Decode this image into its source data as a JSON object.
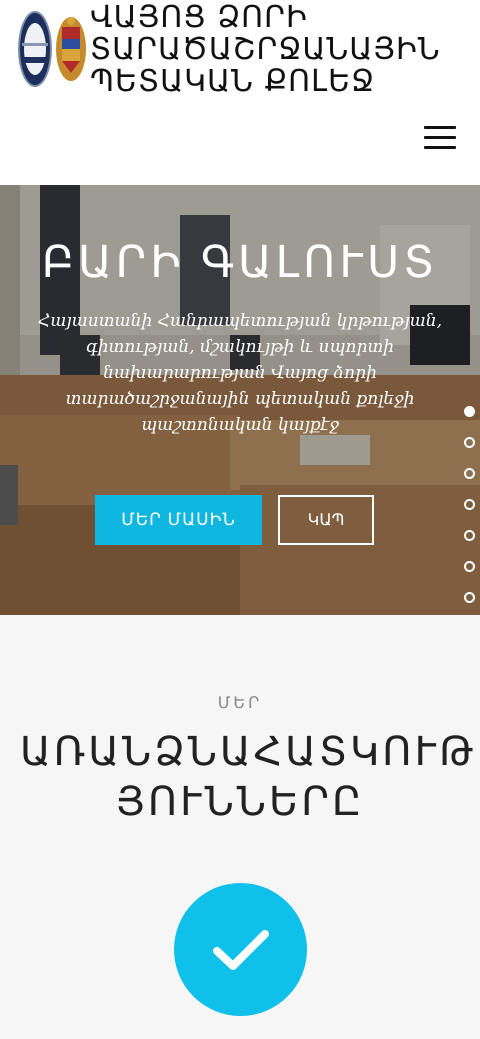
{
  "header": {
    "title": "ՎԱՅՈՑ ՁՈՐԻ ՏԱՐԱԾԱՇՐՋԱՆԱՅԻՆ ՊԵՏԱԿԱՆ ՔՈԼԵՋ",
    "logo_icon": "college-seal-icon",
    "crest_icon": "armenia-coat-of-arms-icon",
    "menu_icon": "hamburger-menu-icon"
  },
  "hero": {
    "title": "ԲԱՐԻ ԳԱԼՈՒՍՏ",
    "subtitle": "Հայաստանի Հանրապետության կրթության, գիտության, մշակույթի և սպորտի նախարարության Վայոց ձորի տարածաշրջանային պետական քոլեջի պաշտոնական կայքէջ",
    "primary_button": "ՄԵՐ ՄԱՍԻՆ",
    "secondary_button": "ԿԱՊ",
    "slide_count": 7,
    "active_slide": 1
  },
  "features": {
    "kicker": "ՄԵՐ",
    "title": "ԱՌԱՆՁՆԱՀԱՏԿՈՒԹ ՅՈՒՆՆԵՐԸ",
    "check_icon": "checkmark-icon"
  },
  "colors": {
    "accent": "#0fb6e0",
    "check_circle": "#0fc0ea",
    "features_bg": "#f6f6f6",
    "text_dark": "#111111"
  }
}
